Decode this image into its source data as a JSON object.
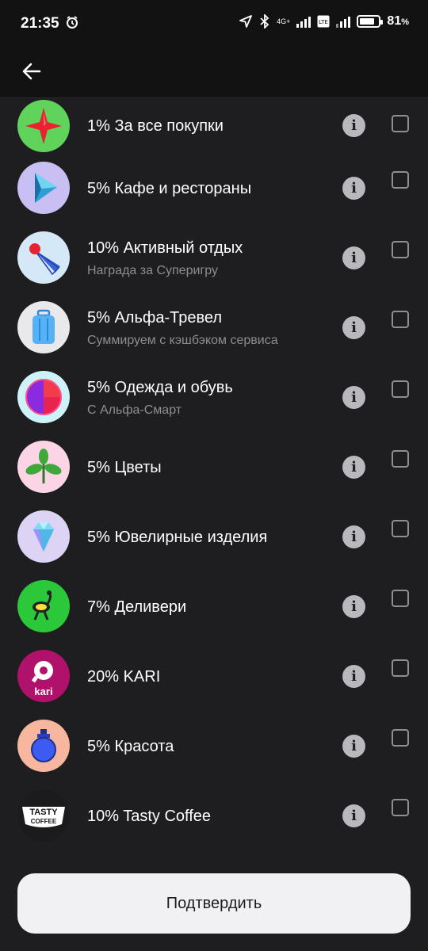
{
  "status_bar": {
    "time": "21:35",
    "network": "4G+",
    "battery_percent": "81",
    "battery_suffix": "%",
    "battery_level": 0.81,
    "icons": [
      "alarm-icon",
      "location-icon",
      "bluetooth-icon",
      "signal-icon",
      "volte-icon",
      "battery-icon"
    ]
  },
  "header": {
    "back_icon": "arrow-left-icon"
  },
  "items": [
    {
      "title": "1% За все покупки",
      "subtitle": "",
      "icon": "red-star-icon",
      "bg": "#5fd35a"
    },
    {
      "title": "5% Кафе и рестораны",
      "subtitle": "",
      "icon": "play-icon",
      "bg": "#c9bff3"
    },
    {
      "title": "10% Активный отдых",
      "subtitle": "Награда за Суперигру",
      "icon": "shuttlecock-icon",
      "bg": "#d5e8f7"
    },
    {
      "title": "5% Альфа-Тревел",
      "subtitle": "Суммируем с кэшбэком сервиса",
      "icon": "suitcase-icon",
      "bg": "#e9e9ec"
    },
    {
      "title": "5% Одежда и обувь",
      "subtitle": "С Альфа-Смарт",
      "icon": "circle-logo-icon",
      "bg": "#cdf3f8"
    },
    {
      "title": "5% Цветы",
      "subtitle": "",
      "icon": "plant-icon",
      "bg": "#fbd4e6"
    },
    {
      "title": "5% Ювелирные изделия",
      "subtitle": "",
      "icon": "diamond-icon",
      "bg": "#dcd3f5"
    },
    {
      "title": "7% Деливери",
      "subtitle": "",
      "icon": "ostrich-icon",
      "bg": "#2bc93a"
    },
    {
      "title": "20% KARI",
      "subtitle": "",
      "icon": "kari-logo-icon",
      "bg": "#b0126b"
    },
    {
      "title": "5% Красота",
      "subtitle": "",
      "icon": "perfume-bottle-icon",
      "bg": "#f7b79e"
    },
    {
      "title": "10% Tasty Coffee",
      "subtitle": "",
      "icon": "tasty-coffee-logo-icon",
      "bg": "#1b1b1d"
    }
  ],
  "logos": {
    "kari": "kari",
    "tasty_line1": "TASTY",
    "tasty_line2": "COFFEE"
  },
  "info_glyph": "i",
  "confirm_label": "Подтвердить"
}
